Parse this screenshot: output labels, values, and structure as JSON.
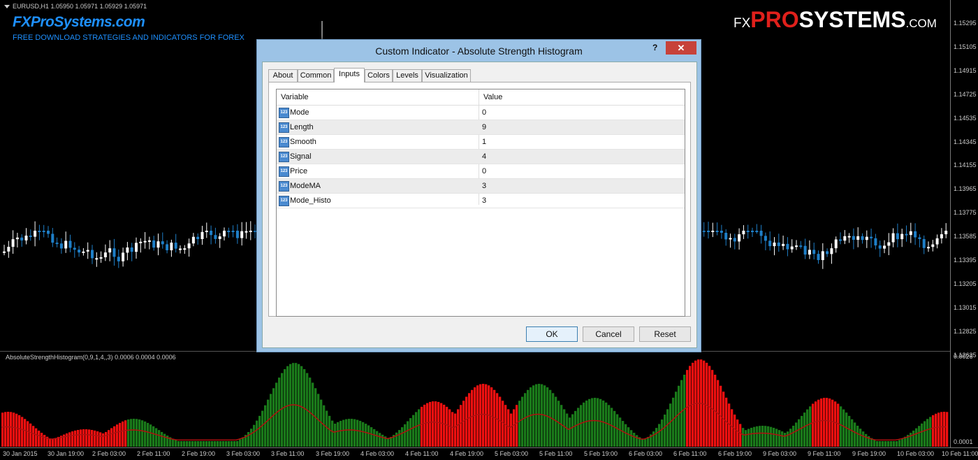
{
  "chart": {
    "symbol_line": "EURUSD,H1  1.05950 1.05971 1.05929 1.05971",
    "brand_left": "FXProSystems.com",
    "brand_tagline": "FREE DOWNLOAD STRATEGIES AND INDICATORS FOR FOREX",
    "brand_right": {
      "fx": "FX",
      "pro": "PRO",
      "systems": "SYSTEMS",
      "com": ".COM"
    },
    "indicator_label": "AbsoluteStrengthHistogram(0,9,1,4,,3) 0.0006 0.0004 0.0006",
    "price_ticks": [
      "1.15295",
      "1.15105",
      "1.14915",
      "1.14725",
      "1.14535",
      "1.14345",
      "1.14155",
      "1.13965",
      "1.13775",
      "1.13585",
      "1.13395",
      "1.13205",
      "1.13015",
      "1.12825",
      "1.12635"
    ],
    "indicator_ticks": [
      "0.0026",
      "0.0001"
    ],
    "time_ticks": [
      "30 Jan 2015",
      "30 Jan 19:00",
      "2 Feb 03:00",
      "2 Feb 11:00",
      "2 Feb 19:00",
      "3 Feb 03:00",
      "3 Feb 11:00",
      "3 Feb 19:00",
      "4 Feb 03:00",
      "4 Feb 11:00",
      "4 Feb 19:00",
      "5 Feb 03:00",
      "5 Feb 11:00",
      "5 Feb 19:00",
      "6 Feb 03:00",
      "6 Feb 11:00",
      "6 Feb 19:00",
      "9 Feb 03:00",
      "9 Feb 11:00",
      "9 Feb 19:00",
      "10 Feb 03:00",
      "10 Feb 11:00"
    ],
    "colors": {
      "up_candle": "#ffffff",
      "down_candle": "#1e7fc8",
      "hist_up": "#1a7a1a",
      "hist_down": "#f01010",
      "signal_line": "#b01010"
    }
  },
  "dialog": {
    "title": "Custom Indicator - Absolute Strength Histogram",
    "help": "?",
    "close": "✕",
    "tabs": [
      "About",
      "Common",
      "Inputs",
      "Colors",
      "Levels",
      "Visualization"
    ],
    "active_tab": "Inputs",
    "columns": {
      "variable": "Variable",
      "value": "Value"
    },
    "inputs": [
      {
        "name": "Mode",
        "value": "0"
      },
      {
        "name": "Length",
        "value": "9"
      },
      {
        "name": "Smooth",
        "value": "1"
      },
      {
        "name": "Signal",
        "value": "4"
      },
      {
        "name": "Price",
        "value": "0"
      },
      {
        "name": "ModeMA",
        "value": "3"
      },
      {
        "name": "Mode_Histo",
        "value": "3"
      }
    ],
    "input_icon": "123",
    "buttons": {
      "ok": "OK",
      "cancel": "Cancel",
      "reset": "Reset"
    }
  }
}
